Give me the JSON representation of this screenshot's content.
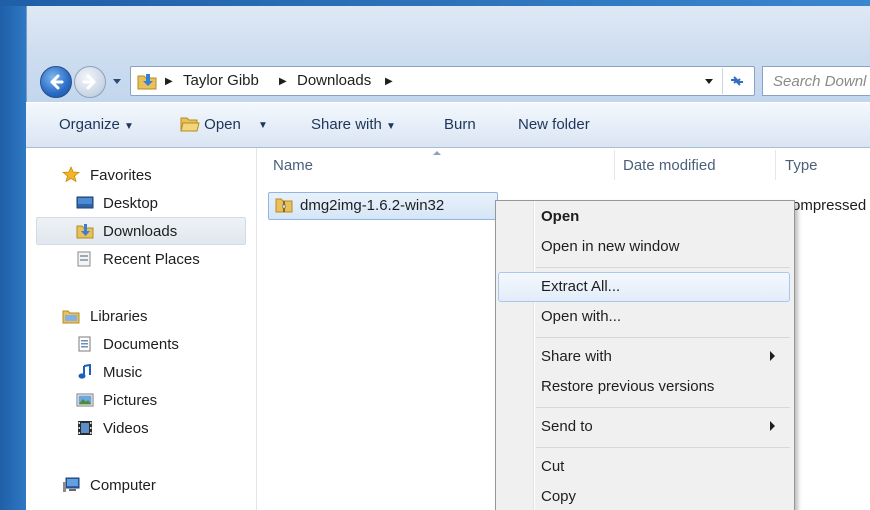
{
  "address_bar": {
    "crumbs": [
      "Taylor Gibb",
      "Downloads"
    ]
  },
  "search": {
    "placeholder": "Search Downl"
  },
  "toolbar": {
    "organize": "Organize",
    "open": "Open",
    "share_with": "Share with",
    "burn": "Burn",
    "new_folder": "New folder"
  },
  "nav_pane": {
    "favorites": "Favorites",
    "desktop": "Desktop",
    "downloads": "Downloads",
    "recent_places": "Recent Places",
    "libraries": "Libraries",
    "documents": "Documents",
    "music": "Music",
    "pictures": "Pictures",
    "videos": "Videos",
    "computer": "Computer"
  },
  "columns": {
    "name": "Name",
    "date_modified": "Date modified",
    "type": "Type"
  },
  "file": {
    "name": "dmg2img-1.6.2-win32",
    "type": "ompressed"
  },
  "context_menu": {
    "open": "Open",
    "open_new_window": "Open in new window",
    "extract_all": "Extract All...",
    "open_with": "Open with...",
    "share_with": "Share with",
    "restore_previous": "Restore previous versions",
    "send_to": "Send to",
    "cut": "Cut",
    "copy": "Copy"
  },
  "colors": {
    "accent": "#2a6bc4",
    "highlight": "#a8c6ee",
    "toolbar_text": "#1e3559"
  }
}
